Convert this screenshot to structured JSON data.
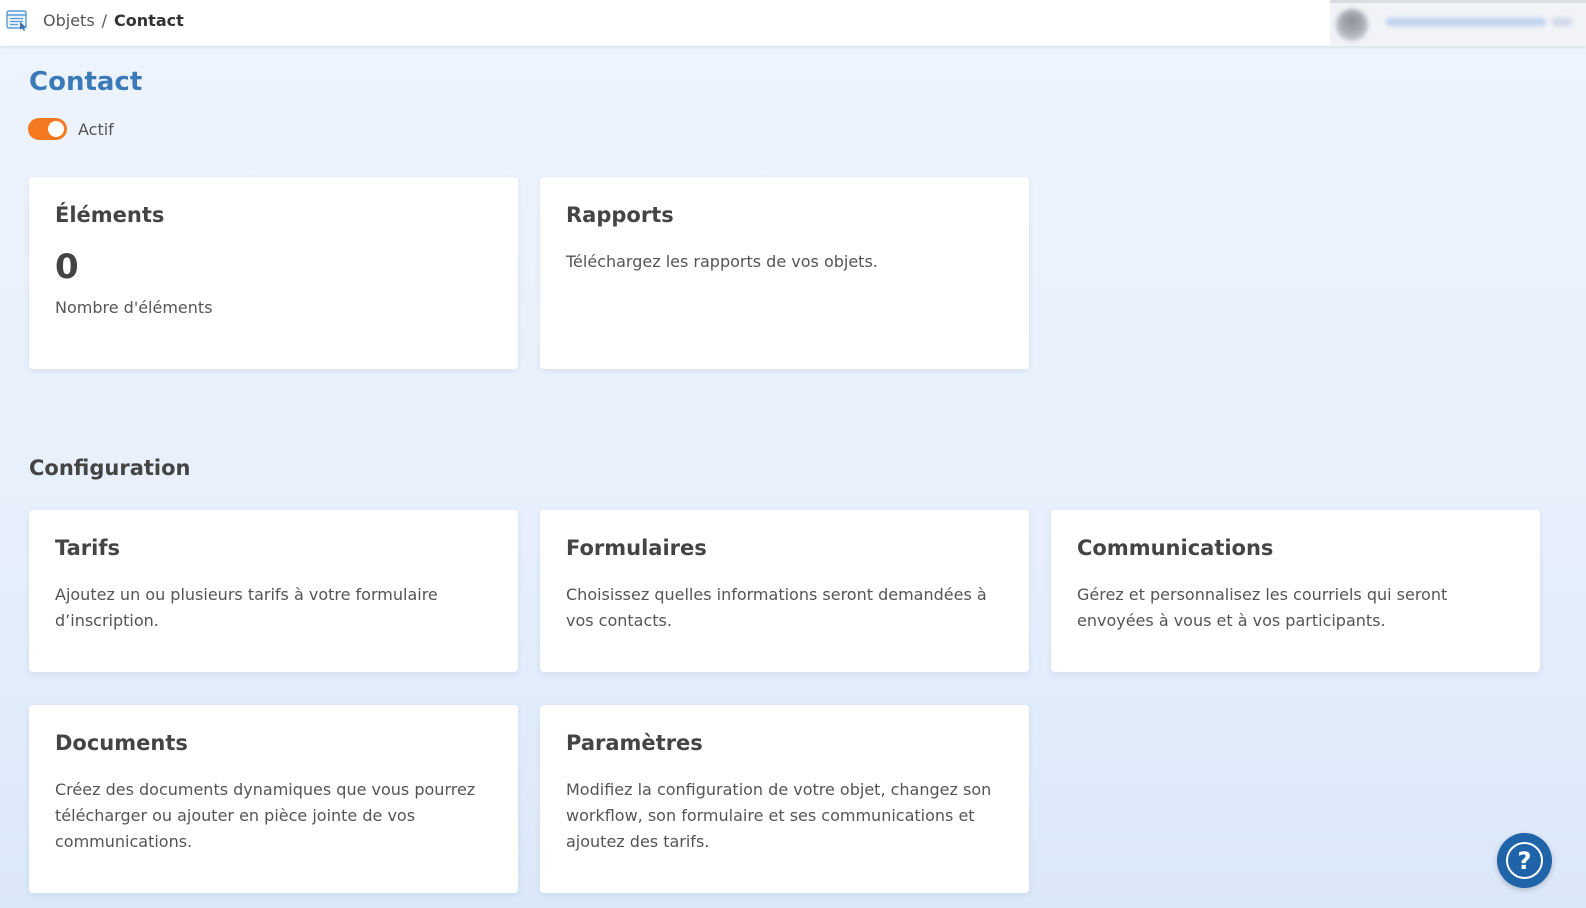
{
  "header": {
    "breadcrumb": {
      "parent": "Objets",
      "separator": "/",
      "current": "Contact"
    },
    "app_icon": "list-window-icon",
    "avatar_icon": "avatar"
  },
  "page": {
    "title": "Contact",
    "toggle": {
      "label": "Actif",
      "on": true,
      "color": "#f47920"
    }
  },
  "summary_cards": [
    {
      "title": "Éléments",
      "number": "0",
      "description": "Nombre d'éléments"
    },
    {
      "title": "Rapports",
      "description": "Téléchargez les rapports de vos objets."
    }
  ],
  "configuration": {
    "title": "Configuration",
    "cards": [
      {
        "title": "Tarifs",
        "description": "Ajoutez un ou plusieurs tarifs à votre formulaire d’inscription."
      },
      {
        "title": "Formulaires",
        "description": "Choisissez quelles informations seront demandées à vos contacts."
      },
      {
        "title": "Communications",
        "description": "Gérez et personnalisez les courriels qui seront envoyées à vous et à vos participants."
      },
      {
        "title": "Documents",
        "description": "Créez des documents dynamiques que vous pourrez télécharger ou ajouter en pièce jointe de vos communications."
      },
      {
        "title": "Paramètres",
        "description": "Modifiez la configuration de votre objet, changez son workflow, son formulaire et ses communications et ajoutez des tarifs."
      }
    ]
  },
  "help": {
    "glyph": "?",
    "icon": "help-icon",
    "color": "#1f63a8"
  },
  "colors": {
    "title_blue": "#3a7ab8",
    "accent_orange": "#f47920"
  }
}
